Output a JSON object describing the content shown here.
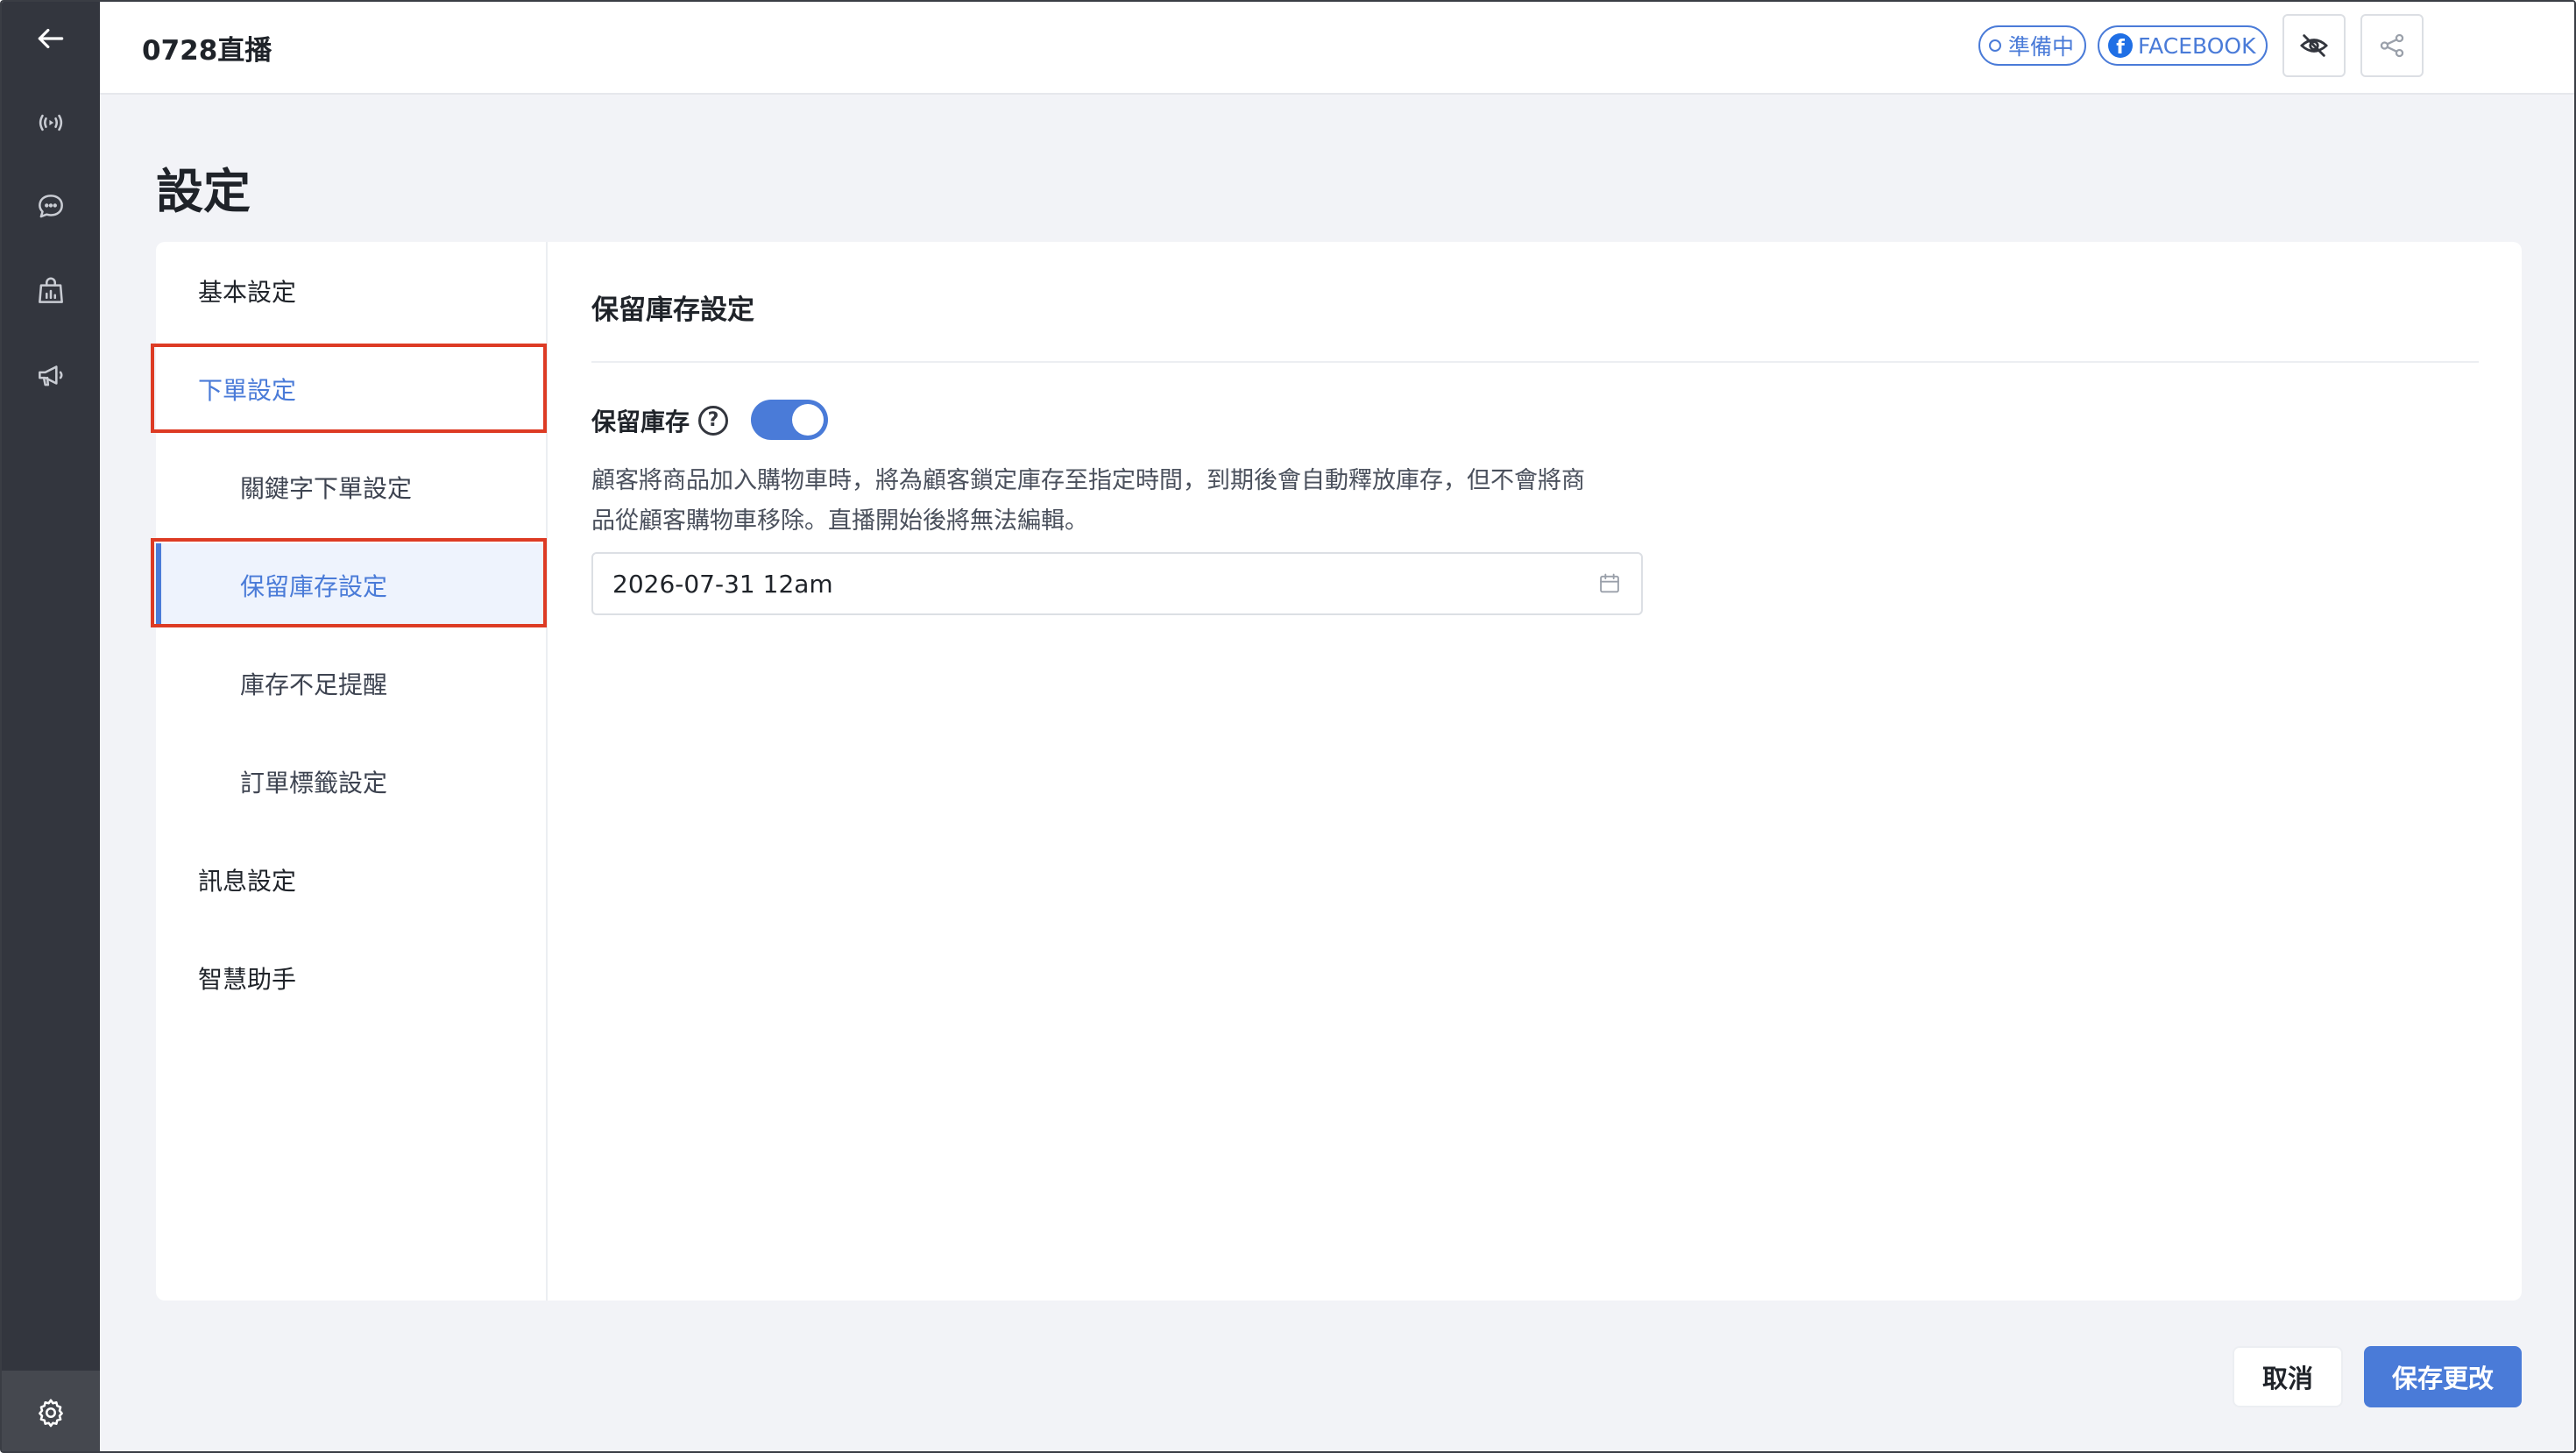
{
  "topbar": {
    "title": "0728直播",
    "status_pill": "準備中",
    "platform_pill": "FACEBOOK"
  },
  "page": {
    "title": "設定"
  },
  "sidebar": {
    "items": [
      {
        "label": "基本設定"
      },
      {
        "label": "下單設定"
      },
      {
        "label": "關鍵字下單設定"
      },
      {
        "label": "保留庫存設定"
      },
      {
        "label": "庫存不足提醒"
      },
      {
        "label": "訂單標籤設定"
      },
      {
        "label": "訊息設定"
      },
      {
        "label": "智慧助手"
      }
    ]
  },
  "content": {
    "section_title": "保留庫存設定",
    "field_label": "保留庫存",
    "help_glyph": "?",
    "description_line1": "顧客將商品加入購物車時，將為顧客鎖定庫存至指定時間，到期後會自動釋放庫存，但不會將商",
    "description_line2": "品從顧客購物車移除。直播開始後將無法編輯。",
    "date_value": "2026-07-31 12am"
  },
  "footer": {
    "cancel_label": "取消",
    "save_label": "保存更改"
  },
  "colors": {
    "accent": "#4a7bd8",
    "rail": "#33363e",
    "highlight": "#dd3b24"
  },
  "icons": {
    "rail": [
      "back-arrow-icon",
      "broadcast-icon",
      "chat-icon",
      "shopping-bag-chart-icon",
      "megaphone-icon",
      "gear-icon"
    ],
    "topbar": [
      "eye-slash-icon",
      "share-icon"
    ],
    "input": "calendar-icon"
  }
}
